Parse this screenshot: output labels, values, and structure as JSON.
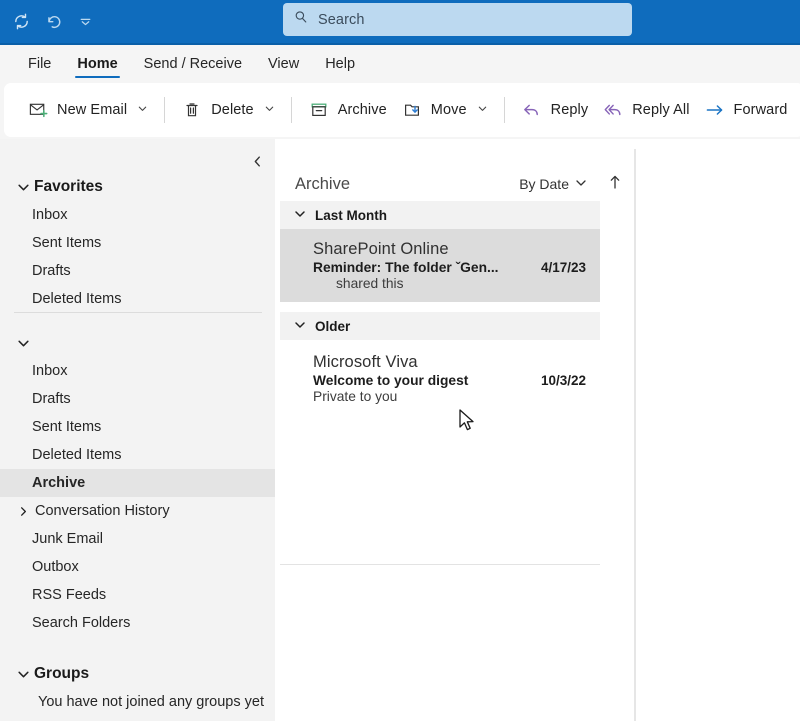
{
  "titlebar": {
    "quick_access": [
      {
        "name": "sync-icon",
        "label": "Send/Receive All Folders"
      },
      {
        "name": "undo-icon",
        "label": "Undo"
      },
      {
        "name": "customize-quick-access-icon",
        "label": "Customize Quick Access Toolbar"
      }
    ],
    "search": {
      "placeholder": "Search",
      "value": "",
      "icon": "search-icon"
    }
  },
  "tabs": [
    {
      "label": "File",
      "active": false
    },
    {
      "label": "Home",
      "active": true
    },
    {
      "label": "Send / Receive",
      "active": false
    },
    {
      "label": "View",
      "active": false
    },
    {
      "label": "Help",
      "active": false
    }
  ],
  "ribbon": {
    "items": [
      {
        "label": "New Email",
        "icon": "new-email-icon",
        "caret": true
      },
      {
        "label": "Delete",
        "icon": "delete-icon",
        "caret": true
      },
      {
        "label": "Archive",
        "icon": "archive-icon",
        "caret": false
      },
      {
        "label": "Move",
        "icon": "move-icon",
        "caret": true
      },
      {
        "label": "Reply",
        "icon": "reply-icon",
        "caret": false
      },
      {
        "label": "Reply All",
        "icon": "reply-all-icon",
        "caret": false
      },
      {
        "label": "Forward",
        "icon": "forward-icon",
        "caret": false
      }
    ]
  },
  "sidebar": {
    "collapse_icon": "chevron-left-icon",
    "favorites": {
      "label": "Favorites",
      "expanded": true,
      "items": [
        {
          "label": "Inbox"
        },
        {
          "label": "Sent Items"
        },
        {
          "label": "Drafts"
        },
        {
          "label": "Deleted Items"
        }
      ]
    },
    "account": {
      "label": "",
      "expanded": true,
      "items": [
        {
          "label": "Inbox",
          "selected": false,
          "expandable": false
        },
        {
          "label": "Drafts",
          "selected": false,
          "expandable": false
        },
        {
          "label": "Sent Items",
          "selected": false,
          "expandable": false
        },
        {
          "label": "Deleted Items",
          "selected": false,
          "expandable": false
        },
        {
          "label": "Archive",
          "selected": true,
          "expandable": false
        },
        {
          "label": "Conversation History",
          "selected": false,
          "expandable": true
        },
        {
          "label": "Junk Email",
          "selected": false,
          "expandable": false
        },
        {
          "label": "Outbox",
          "selected": false,
          "expandable": false
        },
        {
          "label": "RSS Feeds",
          "selected": false,
          "expandable": false
        },
        {
          "label": "Search Folders",
          "selected": false,
          "expandable": false
        }
      ]
    },
    "groups": {
      "label": "Groups",
      "expanded": true,
      "empty_note": "You have not joined any groups yet"
    }
  },
  "message_list": {
    "folder_title": "Archive",
    "sort_by_label": "By Date",
    "sort_direction_icon": "arrow-up-icon",
    "groups": [
      {
        "label": "Last Month",
        "expanded": true,
        "messages": [
          {
            "sender": "SharePoint Online",
            "subject": "Reminder: The folder ˇGen...",
            "date": "4/17/23",
            "preview": "shared this",
            "selected": true
          }
        ]
      },
      {
        "label": "Older",
        "expanded": true,
        "messages": [
          {
            "sender": "Microsoft Viva",
            "subject": "Welcome to your digest",
            "date": "10/3/22",
            "preview": "Private to you",
            "selected": false
          }
        ]
      }
    ]
  },
  "colors": {
    "titlebar": "#0f6cbd",
    "accent": "#0f6cbd",
    "sidebar_bg": "#f3f3f3",
    "selected_row": "#dcdcdc",
    "group_header_bg": "#f2f2f2",
    "reply_purple": "#8764b8",
    "forward_blue": "#0f6cbd",
    "archive_green": "#5fb877"
  }
}
